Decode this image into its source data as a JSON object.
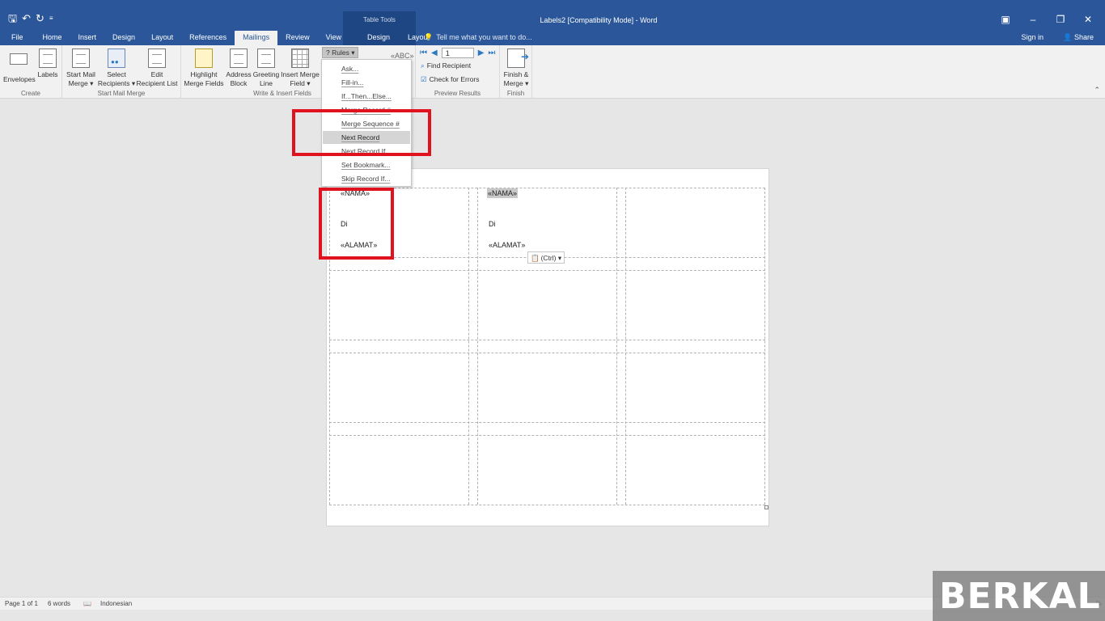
{
  "window": {
    "title": "Labels2 [Compatibility Mode] - Word",
    "contextual_group": "Table Tools",
    "qat_icons": [
      "save-icon",
      "undo-icon",
      "redo-icon",
      "customize-icon"
    ],
    "controls": [
      "ribbon-display-icon",
      "minimize-icon",
      "restore-icon",
      "close-icon"
    ]
  },
  "tabs": [
    {
      "label": "File"
    },
    {
      "label": "Home"
    },
    {
      "label": "Insert"
    },
    {
      "label": "Design"
    },
    {
      "label": "Layout"
    },
    {
      "label": "References"
    },
    {
      "label": "Mailings"
    },
    {
      "label": "Review"
    },
    {
      "label": "View"
    },
    {
      "label": "Design"
    },
    {
      "label": "Layout"
    }
  ],
  "active_tab": "Mailings",
  "tellme": "Tell me what you want to do...",
  "account": {
    "signin": "Sign in",
    "share": "Share"
  },
  "ribbon": {
    "create": {
      "label": "Create",
      "envelopes": "Envelopes",
      "labels": "Labels"
    },
    "start": {
      "label": "Start Mail Merge",
      "start_l1": "Start Mail",
      "start_l2": "Merge ▾",
      "select_l1": "Select",
      "select_l2": "Recipients ▾",
      "edit_l1": "Edit",
      "edit_l2": "Recipient List"
    },
    "write": {
      "label": "Write & Insert Fields",
      "highlight_l1": "Highlight",
      "highlight_l2": "Merge Fields",
      "address_l1": "Address",
      "address_l2": "Block",
      "greeting_l1": "Greeting",
      "greeting_l2": "Line",
      "insert_l1": "Insert Merge",
      "insert_l2": "Field ▾",
      "rules": "Rules ▾"
    },
    "preview": {
      "label": "Preview Results",
      "record": "1",
      "find": "Find Recipient",
      "check": "Check for Errors"
    },
    "finish": {
      "label": "Finish",
      "finish_l1": "Finish &",
      "finish_l2": "Merge ▾"
    }
  },
  "rules_menu": [
    {
      "label": "Ask..."
    },
    {
      "label": "Fill-in..."
    },
    {
      "label": "If...Then...Else..."
    },
    {
      "label": "Merge Record #"
    },
    {
      "label": "Merge Sequence #"
    },
    {
      "label": "Next Record"
    },
    {
      "label": "Next Record If..."
    },
    {
      "label": "Set Bookmark..."
    },
    {
      "label": "Skip Record If..."
    }
  ],
  "highlighted_item": "Next Record",
  "document": {
    "label1": {
      "name": "«NAMA»",
      "di": "Di",
      "address": "«ALAMAT»"
    },
    "label2": {
      "name": "«NAMA»",
      "di": "Di",
      "address": "«ALAMAT»"
    },
    "paste_options": "(Ctrl) ▾"
  },
  "status": {
    "page": "Page 1 of 1",
    "words": "6 words",
    "language": "Indonesian",
    "zoom": "%"
  },
  "watermark": "BERKAL",
  "colors": {
    "word_blue": "#2b579a",
    "highlight_red": "#e0121f",
    "ribbon_bg": "#f1f1f1"
  }
}
